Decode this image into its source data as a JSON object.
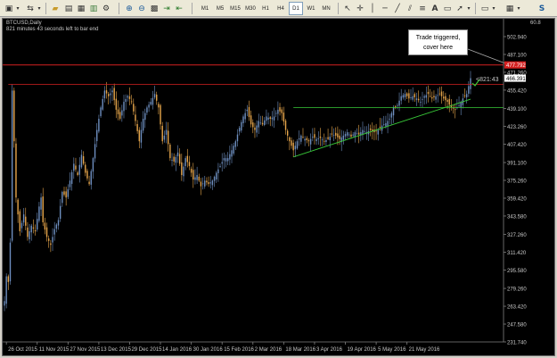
{
  "toolbar": {
    "timeframes": [
      "M1",
      "M5",
      "M15",
      "M30",
      "H1",
      "H4",
      "D1",
      "W1",
      "MN"
    ],
    "active_timeframe": "D1"
  },
  "chart": {
    "symbol_label": "BTCUSD,Daily",
    "timer_label": "821 minutes 43 seconds left to bar end",
    "indicator_value": "60.8",
    "callout_text": "Trade triggered,\ncover here",
    "countdown_label": "<821:43",
    "current_price_label": "466.391",
    "red_line_price_label": "477.792",
    "colors": {
      "background": "#000000",
      "bull": "#6e8fc0",
      "bear": "#e7a64b",
      "red_line": "#d42020",
      "support": "#38c838",
      "axis_text": "#c8c8c8"
    }
  },
  "chart_data": {
    "type": "candlestick",
    "y_ticks": [
      231.74,
      247.58,
      263.42,
      279.26,
      295.58,
      311.42,
      327.26,
      343.58,
      359.42,
      375.26,
      391.1,
      407.42,
      423.26,
      439.1,
      455.42,
      471.26,
      487.1,
      502.94
    ],
    "y_tick_labels": [
      "231.740",
      "247.580",
      "263.420",
      "279.260",
      "295.580",
      "311.420",
      "327.260",
      "343.580",
      "359.420",
      "375.260",
      "391.100",
      "407.420",
      "423.260",
      "439.100",
      "455.420",
      "471.260",
      "487.100",
      "502.940"
    ],
    "x_labels": [
      "26 Oct 2015",
      "11 Nov 2015",
      "27 Nov 2015",
      "13 Dec 2015",
      "29 Dec 2015",
      "14 Jan 2016",
      "30 Jan 2016",
      "15 Feb 2016",
      "2 Mar 2016",
      "18 Mar 2016",
      "3 Apr 2016",
      "19 Apr 2016",
      "5 May 2016",
      "21 May 2016"
    ],
    "ylim": [
      231.74,
      502.94
    ],
    "horizontal_lines": [
      {
        "price": 477.792,
        "color": "#d42020"
      },
      {
        "price": 460.5,
        "color": "#d42020"
      },
      {
        "price": 440.0,
        "color": "#38c838"
      }
    ],
    "trendline": {
      "start_day": 150,
      "start_price": 396,
      "end_day": 236,
      "end_price": 444,
      "color": "#38c838"
    },
    "anchors": [
      [
        0,
        268
      ],
      [
        1,
        290
      ],
      [
        2,
        285
      ],
      [
        3,
        320
      ],
      [
        4,
        455
      ],
      [
        5,
        410
      ],
      [
        6,
        360
      ],
      [
        8,
        330
      ],
      [
        10,
        345
      ],
      [
        12,
        325
      ],
      [
        14,
        335
      ],
      [
        16,
        330
      ],
      [
        18,
        352
      ],
      [
        19,
        360
      ],
      [
        20,
        338
      ],
      [
        22,
        325
      ],
      [
        24,
        318
      ],
      [
        26,
        332
      ],
      [
        28,
        340
      ],
      [
        30,
        365
      ],
      [
        32,
        360
      ],
      [
        34,
        375
      ],
      [
        36,
        390
      ],
      [
        38,
        380
      ],
      [
        40,
        398
      ],
      [
        42,
        382
      ],
      [
        44,
        372
      ],
      [
        46,
        395
      ],
      [
        48,
        420
      ],
      [
        50,
        440
      ],
      [
        52,
        455
      ],
      [
        54,
        450
      ],
      [
        56,
        455
      ],
      [
        58,
        438
      ],
      [
        60,
        430
      ],
      [
        62,
        445
      ],
      [
        64,
        450
      ],
      [
        66,
        445
      ],
      [
        68,
        428
      ],
      [
        70,
        410
      ],
      [
        72,
        430
      ],
      [
        74,
        440
      ],
      [
        76,
        445
      ],
      [
        78,
        452
      ],
      [
        80,
        440
      ],
      [
        82,
        410
      ],
      [
        84,
        420
      ],
      [
        86,
        395
      ],
      [
        88,
        392
      ],
      [
        90,
        400
      ],
      [
        92,
        380
      ],
      [
        94,
        395
      ],
      [
        96,
        388
      ],
      [
        98,
        376
      ],
      [
        100,
        380
      ],
      [
        102,
        370
      ],
      [
        104,
        375
      ],
      [
        106,
        372
      ],
      [
        108,
        375
      ],
      [
        110,
        382
      ],
      [
        112,
        388
      ],
      [
        114,
        395
      ],
      [
        116,
        395
      ],
      [
        118,
        402
      ],
      [
        120,
        410
      ],
      [
        122,
        422
      ],
      [
        124,
        432
      ],
      [
        126,
        438
      ],
      [
        128,
        425
      ],
      [
        130,
        420
      ],
      [
        132,
        428
      ],
      [
        134,
        425
      ],
      [
        136,
        432
      ],
      [
        138,
        430
      ],
      [
        140,
        432
      ],
      [
        142,
        438
      ],
      [
        144,
        435
      ],
      [
        146,
        420
      ],
      [
        148,
        410
      ],
      [
        150,
        402
      ],
      [
        152,
        410
      ],
      [
        154,
        415
      ],
      [
        156,
        412
      ],
      [
        158,
        410
      ],
      [
        160,
        414
      ],
      [
        162,
        412
      ],
      [
        164,
        413
      ],
      [
        166,
        410
      ],
      [
        168,
        412
      ],
      [
        170,
        416
      ],
      [
        172,
        415
      ],
      [
        174,
        412
      ],
      [
        176,
        415
      ],
      [
        178,
        418
      ],
      [
        180,
        414
      ],
      [
        182,
        418
      ],
      [
        184,
        416
      ],
      [
        186,
        420
      ],
      [
        188,
        418
      ],
      [
        190,
        420
      ],
      [
        192,
        418
      ],
      [
        194,
        420
      ],
      [
        196,
        424
      ],
      [
        198,
        426
      ],
      [
        200,
        430
      ],
      [
        202,
        440
      ],
      [
        204,
        442
      ],
      [
        206,
        450
      ],
      [
        208,
        452
      ],
      [
        210,
        448
      ],
      [
        212,
        450
      ],
      [
        214,
        448
      ],
      [
        216,
        445
      ],
      [
        218,
        450
      ],
      [
        220,
        452
      ],
      [
        222,
        448
      ],
      [
        224,
        450
      ],
      [
        226,
        452
      ],
      [
        228,
        448
      ],
      [
        230,
        445
      ],
      [
        232,
        440
      ],
      [
        234,
        438
      ],
      [
        236,
        442
      ],
      [
        238,
        448
      ],
      [
        240,
        452
      ],
      [
        242,
        466
      ]
    ]
  }
}
